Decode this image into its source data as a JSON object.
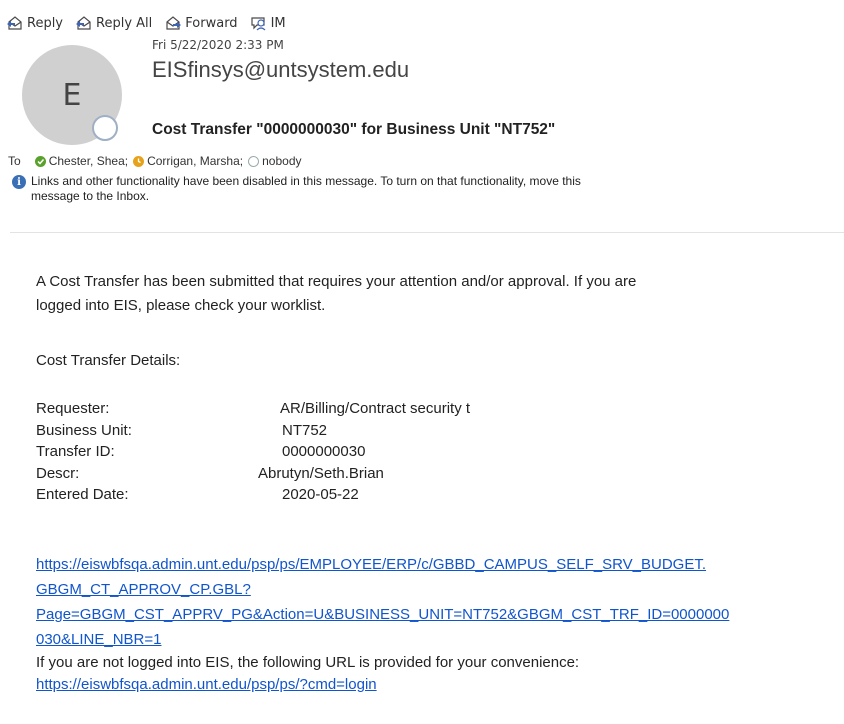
{
  "toolbar": {
    "reply_label": "Reply",
    "reply_all_label": "Reply All",
    "forward_label": "Forward",
    "im_label": "IM",
    "icon_names": [
      "reply-icon",
      "reply-all-icon",
      "forward-icon",
      "im-icon"
    ]
  },
  "message": {
    "avatar_initial": "E",
    "date": "Fri 5/22/2020 2:33 PM",
    "sender": "EISfinsys@untsystem.edu",
    "subject": "Cost Transfer \"0000000030\" for Business Unit \"NT752\"",
    "to_label": "To",
    "recipients": [
      {
        "name": "Chester, Shea;",
        "status": "available"
      },
      {
        "name": "Corrigan, Marsha;",
        "status": "away"
      },
      {
        "name": "nobody",
        "status": "unknown"
      }
    ],
    "info_notice_line1": "Links and other functionality have been disabled in this message. To turn on that functionality, move this",
    "info_notice_line2": "message to the Inbox."
  },
  "body": {
    "intro_line1": "A Cost Transfer  has been submitted that requires your attention and/or approval.  If you are",
    "intro_line2": "logged into EIS, please check your worklist.",
    "details_title": "Cost Transfer Details:",
    "details": [
      {
        "label": "Requester:",
        "value": "AR/Billing/Contract security t"
      },
      {
        "label": "Business Unit:",
        "value": "NT752"
      },
      {
        "label": "Transfer ID:",
        "value": "0000000030"
      },
      {
        "label": "Descr:",
        "value": "Abrutyn/Seth.Brian"
      },
      {
        "label": "Entered Date:",
        "value": "2020-05-22"
      }
    ],
    "approval_link_lines": [
      "https://eiswbfsqa.admin.unt.edu/psp/ps/EMPLOYEE/ERP/c/GBBD_CAMPUS_SELF_SRV_BUDGET.",
      "GBGM_CT_APPROV_CP.GBL?",
      "Page=GBGM_CST_APPRV_PG&Action=U&BUSINESS_UNIT=NT752&GBGM_CST_TRF_ID=0000000",
      "030&LINE_NBR=1"
    ],
    "not_logged_text": "If you are not logged into EIS, the following URL is provided for your convenience:",
    "login_link": "https://eiswbfsqa.admin.unt.edu/psp/ps/?cmd=login"
  },
  "colors": {
    "link": "#1155cc",
    "available": "#5aa02c",
    "away": "#e7a21c",
    "info": "#3a6fb5",
    "avatar_bg": "#d0d0d0"
  }
}
